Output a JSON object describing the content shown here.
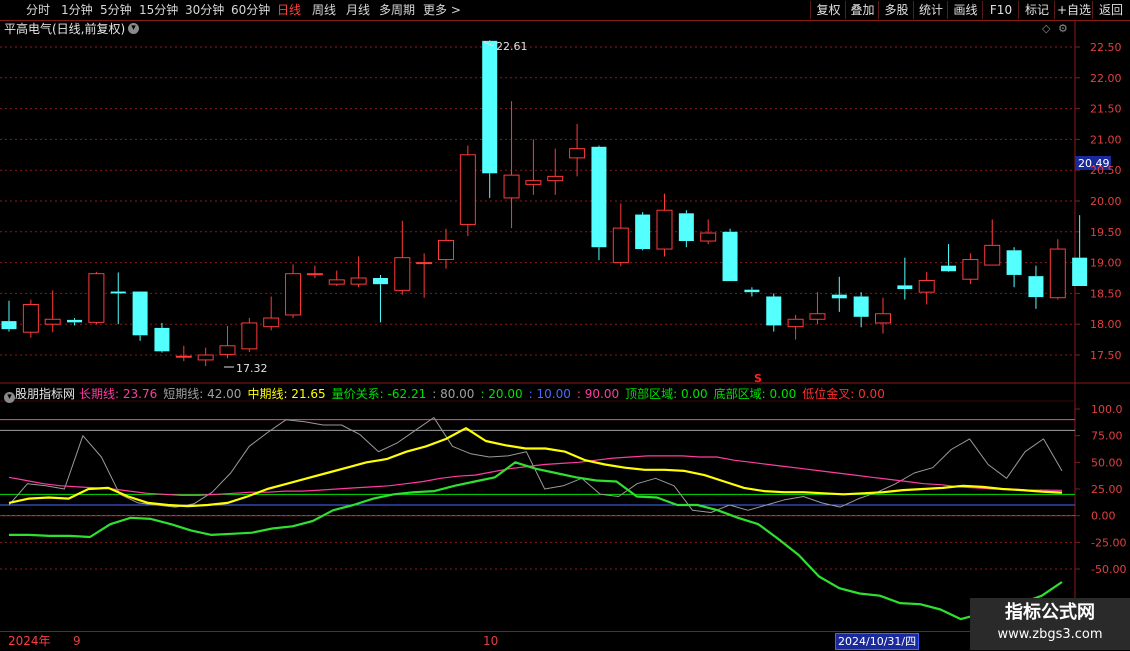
{
  "toolbar": {
    "periods": [
      {
        "label": "分时",
        "active": false
      },
      {
        "label": "1分钟",
        "active": false
      },
      {
        "label": "5分钟",
        "active": false
      },
      {
        "label": "15分钟",
        "active": false
      },
      {
        "label": "30分钟",
        "active": false
      },
      {
        "label": "60分钟",
        "active": false
      },
      {
        "label": "日线",
        "active": true
      },
      {
        "label": "周线",
        "active": false
      },
      {
        "label": "月线",
        "active": false
      },
      {
        "label": "多周期",
        "active": false
      },
      {
        "label": "更多 >",
        "active": false
      }
    ],
    "right_buttons": [
      "复权",
      "叠加",
      "多股",
      "统计",
      "画线",
      "F10",
      "标记",
      "+自选",
      "返回"
    ]
  },
  "stock": {
    "title": "平高电气(日线,前复权)"
  },
  "price_axis": {
    "ticks": [
      "22.50",
      "22.00",
      "21.50",
      "21.00",
      "20.50",
      "20.00",
      "19.50",
      "19.00",
      "18.50",
      "18.00",
      "17.50"
    ],
    "current_price": "20.49"
  },
  "annotations": {
    "high_label": "22.61",
    "low_label": "17.32",
    "signal_marker": "S"
  },
  "indicator": {
    "name": "股朋指标网",
    "items": [
      {
        "text": "长期线: 23.76",
        "color": "#ff3ca0"
      },
      {
        "text": "短期线: 42.00",
        "color": "#a0a0a0"
      },
      {
        "text": "中期线: 21.65",
        "color": "#ffff00"
      },
      {
        "text": "量价关系: -62.21",
        "color": "#00e000"
      },
      {
        "text": ": 80.00",
        "color": "#a0a0a0"
      },
      {
        "text": ": 20.00",
        "color": "#00e000"
      },
      {
        "text": ": 10.00",
        "color": "#4a6aff"
      },
      {
        "text": ": 90.00",
        "color": "#ff3ca0"
      },
      {
        "text": "顶部区域: 0.00",
        "color": "#00e000"
      },
      {
        "text": "底部区域: 0.00",
        "color": "#00e000"
      },
      {
        "text": "低位金叉: 0.00",
        "color": "#ff3030"
      }
    ],
    "axis_ticks": [
      "100.0",
      "75.00",
      "50.00",
      "25.00",
      "0.00",
      "-25.00",
      "-50.00"
    ]
  },
  "bottom": {
    "year_label": "2024年",
    "month_labels": [
      "9",
      "10"
    ],
    "cursor_date": "2024/10/31/四"
  },
  "watermark": {
    "line1": "指标公式网",
    "line2": "www.zbgs3.com"
  },
  "chart_data": {
    "type": "candlestick",
    "candles": [
      {
        "o": 18.05,
        "h": 18.38,
        "l": 17.88,
        "c": 17.92
      },
      {
        "o": 17.87,
        "h": 18.4,
        "l": 17.78,
        "c": 18.32
      },
      {
        "o": 18.0,
        "h": 18.55,
        "l": 17.87,
        "c": 18.08
      },
      {
        "o": 18.07,
        "h": 18.1,
        "l": 17.98,
        "c": 18.03
      },
      {
        "o": 18.03,
        "h": 18.85,
        "l": 18.0,
        "c": 18.82
      },
      {
        "o": 18.53,
        "h": 18.84,
        "l": 18.0,
        "c": 18.5
      },
      {
        "o": 18.53,
        "h": 18.53,
        "l": 17.73,
        "c": 17.82
      },
      {
        "o": 17.94,
        "h": 18.02,
        "l": 17.54,
        "c": 17.56
      },
      {
        "o": 17.48,
        "h": 17.65,
        "l": 17.4,
        "c": 17.48
      },
      {
        "o": 17.42,
        "h": 17.62,
        "l": 17.32,
        "c": 17.5
      },
      {
        "o": 17.51,
        "h": 17.97,
        "l": 17.45,
        "c": 17.65
      },
      {
        "o": 17.6,
        "h": 18.1,
        "l": 17.55,
        "c": 18.02
      },
      {
        "o": 17.96,
        "h": 18.45,
        "l": 17.9,
        "c": 18.1
      },
      {
        "o": 18.15,
        "h": 18.97,
        "l": 18.1,
        "c": 18.82
      },
      {
        "o": 18.82,
        "h": 18.95,
        "l": 18.75,
        "c": 18.82
      },
      {
        "o": 18.65,
        "h": 18.87,
        "l": 18.62,
        "c": 18.72
      },
      {
        "o": 18.65,
        "h": 19.1,
        "l": 18.6,
        "c": 18.75
      },
      {
        "o": 18.75,
        "h": 18.8,
        "l": 18.03,
        "c": 18.65
      },
      {
        "o": 18.55,
        "h": 19.68,
        "l": 18.48,
        "c": 19.08
      },
      {
        "o": 19.0,
        "h": 19.15,
        "l": 18.43,
        "c": 19.0
      },
      {
        "o": 19.05,
        "h": 19.55,
        "l": 18.9,
        "c": 19.36
      },
      {
        "o": 19.62,
        "h": 20.9,
        "l": 19.43,
        "c": 20.75
      },
      {
        "o": 22.6,
        "h": 22.61,
        "l": 20.05,
        "c": 20.45
      },
      {
        "o": 20.05,
        "h": 21.62,
        "l": 19.56,
        "c": 20.42
      },
      {
        "o": 20.27,
        "h": 21.0,
        "l": 20.1,
        "c": 20.33
      },
      {
        "o": 20.33,
        "h": 20.85,
        "l": 20.1,
        "c": 20.4
      },
      {
        "o": 20.7,
        "h": 21.25,
        "l": 20.4,
        "c": 20.85
      },
      {
        "o": 20.88,
        "h": 20.9,
        "l": 19.04,
        "c": 19.25
      },
      {
        "o": 19.0,
        "h": 19.96,
        "l": 18.94,
        "c": 19.56
      },
      {
        "o": 19.78,
        "h": 19.82,
        "l": 19.2,
        "c": 19.22
      },
      {
        "o": 19.22,
        "h": 20.12,
        "l": 19.1,
        "c": 19.85
      },
      {
        "o": 19.8,
        "h": 19.85,
        "l": 19.25,
        "c": 19.35
      },
      {
        "o": 19.35,
        "h": 19.7,
        "l": 19.3,
        "c": 19.48
      },
      {
        "o": 19.5,
        "h": 19.55,
        "l": 18.73,
        "c": 18.7
      },
      {
        "o": 18.56,
        "h": 18.6,
        "l": 18.45,
        "c": 18.52
      },
      {
        "o": 18.45,
        "h": 18.5,
        "l": 17.88,
        "c": 17.98
      },
      {
        "o": 17.96,
        "h": 18.15,
        "l": 17.75,
        "c": 18.08
      },
      {
        "o": 18.08,
        "h": 18.52,
        "l": 18.0,
        "c": 18.17
      },
      {
        "o": 18.48,
        "h": 18.77,
        "l": 18.2,
        "c": 18.42
      },
      {
        "o": 18.45,
        "h": 18.52,
        "l": 17.95,
        "c": 18.12
      },
      {
        "o": 18.02,
        "h": 18.43,
        "l": 17.85,
        "c": 18.17
      },
      {
        "o": 18.63,
        "h": 19.08,
        "l": 18.4,
        "c": 18.57
      },
      {
        "o": 18.52,
        "h": 18.85,
        "l": 18.32,
        "c": 18.71
      },
      {
        "o": 18.95,
        "h": 19.3,
        "l": 18.85,
        "c": 18.86
      },
      {
        "o": 18.73,
        "h": 19.15,
        "l": 18.65,
        "c": 19.05
      },
      {
        "o": 18.96,
        "h": 19.7,
        "l": 19.0,
        "c": 19.28
      },
      {
        "o": 19.2,
        "h": 19.25,
        "l": 18.6,
        "c": 18.8
      },
      {
        "o": 18.78,
        "h": 18.95,
        "l": 18.25,
        "c": 18.44
      },
      {
        "o": 18.43,
        "h": 19.38,
        "l": 18.4,
        "c": 19.22
      },
      {
        "o": 19.08,
        "h": 19.77,
        "l": 18.75,
        "c": 18.62
      }
    ],
    "price_range": [
      17.32,
      22.61
    ],
    "indicator_lines": {
      "long": [
        36,
        33,
        30,
        28,
        27,
        26,
        25,
        23,
        21,
        20,
        19,
        19,
        20,
        21,
        22,
        22,
        23,
        23,
        24,
        25,
        26,
        27,
        28,
        30,
        32,
        35,
        37,
        38,
        41,
        44,
        46,
        48,
        49,
        50,
        52,
        54,
        55,
        56,
        56,
        56,
        55,
        55,
        52,
        50,
        48,
        46,
        44,
        42,
        40,
        38,
        36,
        34,
        32,
        30,
        29,
        27,
        26,
        25,
        25,
        24,
        24,
        23.76
      ],
      "short": [
        10,
        30,
        28,
        25,
        75,
        55,
        20,
        12,
        10,
        8,
        11,
        22,
        40,
        65,
        78,
        90,
        88,
        85,
        85,
        76,
        60,
        68,
        80,
        92,
        65,
        58,
        55,
        56,
        60,
        25,
        28,
        35,
        20,
        18,
        30,
        35,
        28,
        5,
        3,
        10,
        5,
        10,
        15,
        18,
        12,
        8,
        16,
        22,
        30,
        40,
        45,
        62,
        72,
        48,
        35,
        60,
        72,
        42
      ],
      "mid": [
        12,
        16,
        17,
        16,
        25,
        26,
        18,
        12,
        10,
        9,
        10,
        12,
        18,
        25,
        30,
        35,
        40,
        45,
        50,
        53,
        60,
        65,
        72,
        82,
        70,
        66,
        63,
        63,
        60,
        52,
        48,
        45,
        43,
        43,
        42,
        38,
        32,
        26,
        23,
        22,
        22,
        21,
        20,
        21,
        22,
        24,
        25,
        26,
        28,
        27,
        25,
        24,
        22.5,
        21.65
      ],
      "volume_price": [
        -18,
        -18,
        -19,
        -19,
        -20,
        -8,
        -2,
        -3,
        -8,
        -14,
        -18,
        -17,
        -16,
        -12,
        -10,
        -5,
        5,
        10,
        16,
        20,
        22,
        23,
        28,
        32,
        36,
        50,
        44,
        40,
        36,
        33,
        32,
        18,
        17,
        10,
        10,
        5,
        -2,
        -8,
        -22,
        -37,
        -57,
        -68,
        -73,
        -75,
        -82,
        -83,
        -88,
        -97,
        -92,
        -88,
        -82,
        -75,
        -62.21
      ],
      "levels": [
        90,
        80,
        20,
        10,
        0
      ],
      "range": [
        -60,
        100
      ]
    }
  }
}
